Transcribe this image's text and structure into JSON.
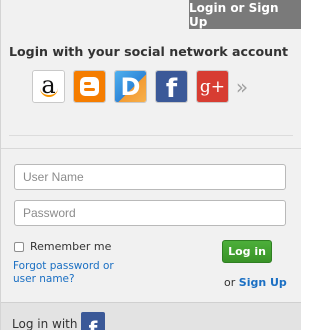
{
  "header": {
    "tab_label": "Login or Sign Up"
  },
  "social": {
    "title": "Login with your social network account",
    "providers": [
      {
        "name": "Amazon",
        "icon": "amazon-icon"
      },
      {
        "name": "Blogger",
        "icon": "blogger-icon"
      },
      {
        "name": "Disqus",
        "icon": "disqus-icon"
      },
      {
        "name": "Facebook",
        "icon": "facebook-icon"
      },
      {
        "name": "Google+",
        "icon": "google-plus-icon",
        "glyph": "g+"
      }
    ],
    "more_glyph": "»"
  },
  "form": {
    "username_placeholder": "User Name",
    "username_value": "",
    "password_placeholder": "Password",
    "password_value": "",
    "remember_label": "Remember me",
    "remember_checked": false,
    "forgot_label": "Forgot password or user name?",
    "login_label": "Log in",
    "signup_prefix": "or",
    "signup_label": "Sign Up"
  },
  "footer": {
    "label": "Log in with",
    "icon": "facebook-icon"
  },
  "colors": {
    "tab_bg": "#7a7a7a",
    "link": "#1a6fc3",
    "login_button": "#3fa22f",
    "facebook": "#3b5998",
    "blogger": "#f57d00",
    "gplus": "#d73d32"
  }
}
